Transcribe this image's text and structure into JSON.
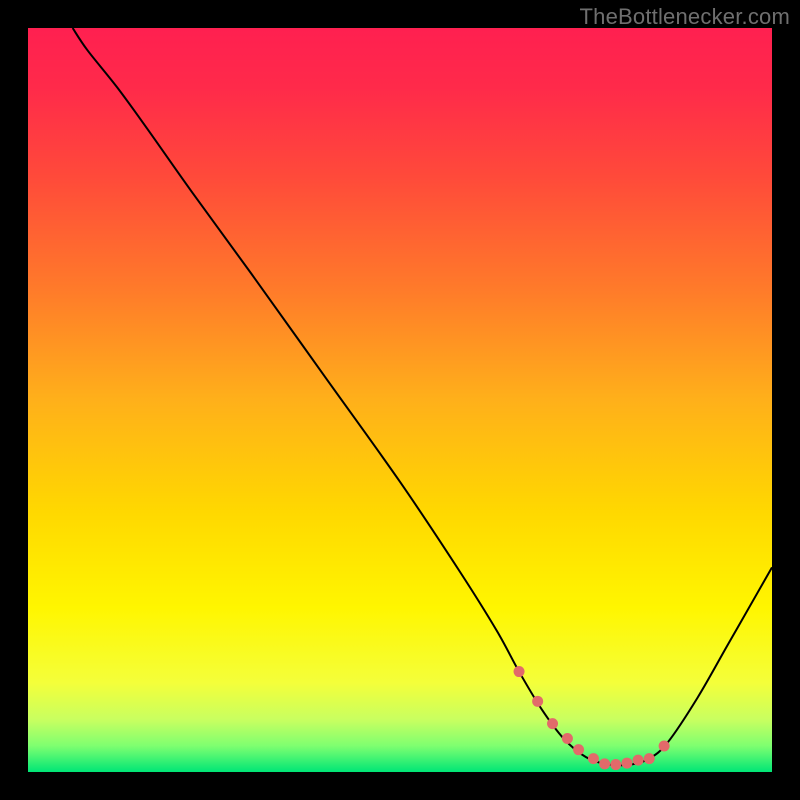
{
  "watermark": "TheBottlenecker.com",
  "chart_data": {
    "type": "line",
    "title": "",
    "xlabel": "",
    "ylabel": "",
    "xlim": [
      0,
      100
    ],
    "ylim": [
      0,
      100
    ],
    "background_gradient": {
      "stops": [
        {
          "offset": 0.0,
          "color": "#ff2050"
        },
        {
          "offset": 0.08,
          "color": "#ff2a4a"
        },
        {
          "offset": 0.2,
          "color": "#ff4a3a"
        },
        {
          "offset": 0.35,
          "color": "#ff7a2a"
        },
        {
          "offset": 0.5,
          "color": "#ffb01a"
        },
        {
          "offset": 0.65,
          "color": "#ffd800"
        },
        {
          "offset": 0.78,
          "color": "#fff600"
        },
        {
          "offset": 0.88,
          "color": "#f4ff3a"
        },
        {
          "offset": 0.93,
          "color": "#c8ff60"
        },
        {
          "offset": 0.965,
          "color": "#7eff70"
        },
        {
          "offset": 1.0,
          "color": "#00e676"
        }
      ]
    },
    "series": [
      {
        "name": "bottleneck-curve",
        "color": "#000000",
        "stroke_width": 2.0,
        "x": [
          6,
          8,
          12,
          16,
          22,
          30,
          40,
          50,
          58,
          63,
          66,
          69,
          72,
          75,
          78,
          81,
          83.5,
          86,
          90,
          94,
          98,
          100
        ],
        "y": [
          100,
          97,
          92,
          86.5,
          78,
          67,
          53,
          39,
          27,
          19,
          13.5,
          8.5,
          4.5,
          2,
          1,
          1,
          1.8,
          4,
          10,
          17,
          24,
          27.5
        ]
      }
    ],
    "highlight_points": {
      "name": "sweet-spot",
      "color": "#e26a6a",
      "radius": 5.5,
      "x": [
        66,
        68.5,
        70.5,
        72.5,
        74,
        76,
        77.5,
        79,
        80.5,
        82,
        83.5,
        85.5
      ],
      "y": [
        13.5,
        9.5,
        6.5,
        4.5,
        3,
        1.8,
        1.1,
        1,
        1.2,
        1.6,
        1.8,
        3.5
      ]
    }
  }
}
